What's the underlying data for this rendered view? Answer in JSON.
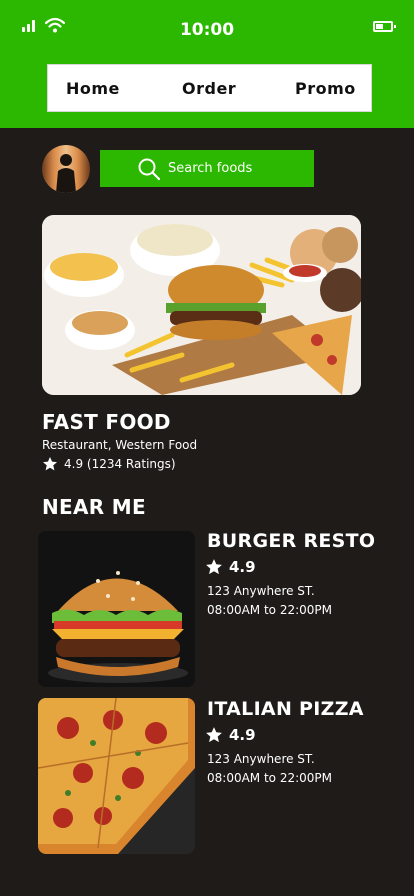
{
  "status_bar": {
    "time": "10:00"
  },
  "nav": {
    "items": [
      "Home",
      "Order",
      "Promo"
    ]
  },
  "search": {
    "placeholder": "Search foods"
  },
  "featured": {
    "title": "FAST FOOD",
    "subtitle": "Restaurant, Western Food",
    "rating": "4.9 (1234 Ratings)"
  },
  "near_me": {
    "title": "NEAR ME",
    "items": [
      {
        "name": "BURGER RESTO",
        "rating": "4.9",
        "address": "123 Anywhere ST.",
        "hours": "08:00AM to 22:00PM"
      },
      {
        "name": "ITALIAN PIZZA",
        "rating": "4.9",
        "address": "123 Anywhere ST.",
        "hours": "08:00AM to 22:00PM"
      }
    ]
  },
  "colors": {
    "accent": "#2cb800",
    "background": "#1e1b18",
    "nav_background": "#ffffff"
  },
  "icons": [
    "signal-icon",
    "wifi-icon",
    "battery-icon",
    "search-icon",
    "star-icon"
  ]
}
